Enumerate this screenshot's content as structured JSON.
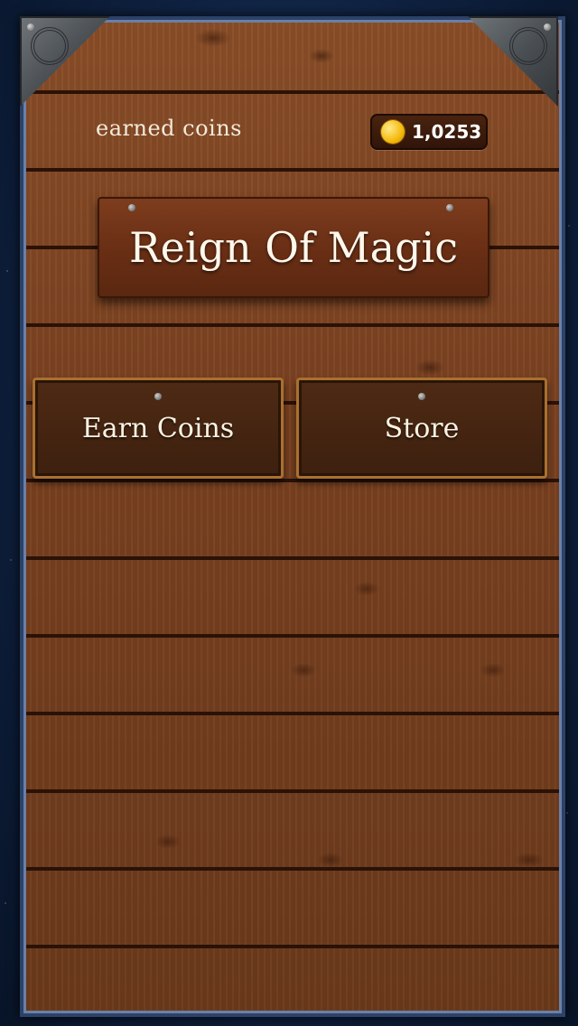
{
  "header": {
    "earned_label": "earned coins",
    "coins": "1,0253"
  },
  "title": "Reign Of Magic",
  "buttons": {
    "earn_coins": "Earn Coins",
    "store": "Store"
  },
  "icons": {
    "coin": "gold-coin-icon",
    "corner_left": "metal-corner-ornament",
    "corner_right": "metal-corner-ornament"
  },
  "colors": {
    "wood": "#7a4120",
    "frame": "#2c4268",
    "coin": "#f5b90b",
    "text": "#f4eadb"
  }
}
